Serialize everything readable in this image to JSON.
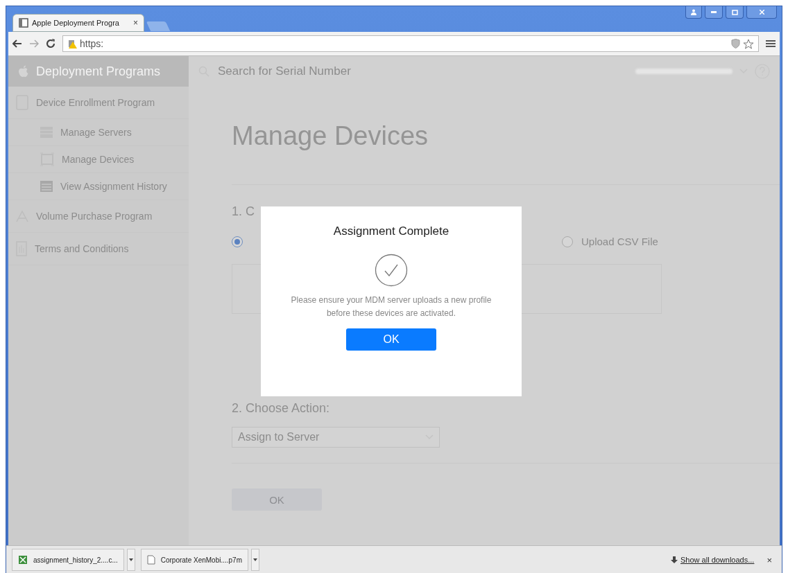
{
  "browser": {
    "tabs": [
      {
        "title": "Apple Deployment Progra",
        "selected": true
      }
    ],
    "close_tab": "×",
    "address": "https:"
  },
  "sidebar": {
    "header": "Deployment Programs",
    "items": [
      {
        "label": "Device Enrollment Program",
        "kind": "device",
        "children": [
          {
            "label": "Manage Servers",
            "kind": "servers"
          },
          {
            "label": "Manage Devices",
            "kind": "devices"
          },
          {
            "label": "View Assignment History",
            "kind": "history"
          }
        ]
      },
      {
        "label": "Volume Purchase Program",
        "kind": "store"
      },
      {
        "label": "Terms and Conditions",
        "kind": "terms"
      }
    ]
  },
  "search": {
    "placeholder": "Search for Serial Number"
  },
  "main": {
    "title": "Manage Devices",
    "step1": "1. C",
    "radios": [
      {
        "selected": true
      },
      {
        "label": "Upload CSV File",
        "selected": false
      }
    ],
    "step2": "2. Choose Action:",
    "select": {
      "value": "Assign to Server"
    },
    "button": {
      "label": "OK",
      "disabled": true
    }
  },
  "dialog": {
    "title": "Assignment Complete",
    "message": "Please ensure your MDM server uploads a new profile before these devices are activated.",
    "button": "OK"
  },
  "downloads": {
    "items": [
      {
        "name": "assignment_history_2....c...",
        "kind": "spreadsheet"
      },
      {
        "name": "Corporate XenMobi....p7m",
        "kind": "file"
      }
    ],
    "show_all": "Show all downloads...",
    "close": "×"
  }
}
